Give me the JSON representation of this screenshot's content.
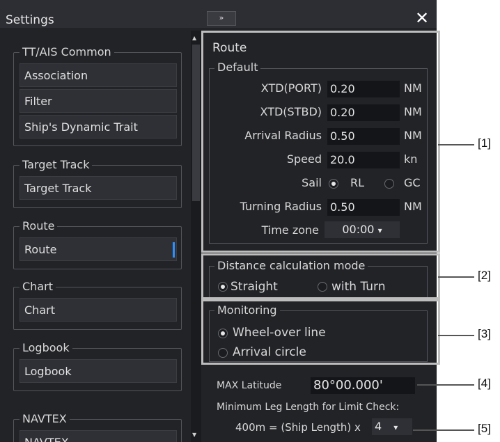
{
  "window": {
    "title": "Settings",
    "expand_icon": "double-chevron-right",
    "close_icon": "close-x"
  },
  "sidebar": {
    "groups": [
      {
        "title": "TT/AIS Common",
        "items": [
          "Association",
          "Filter",
          "Ship's Dynamic Trait"
        ]
      },
      {
        "title": "Target Track",
        "items": [
          "Target Track"
        ]
      },
      {
        "title": "Route",
        "items": [
          "Route"
        ],
        "selected": "Route"
      },
      {
        "title": "Chart",
        "items": [
          "Chart"
        ]
      },
      {
        "title": "Logbook",
        "items": [
          "Logbook"
        ]
      },
      {
        "title": "NAVTEX",
        "items": [
          "NAVTEX"
        ]
      }
    ]
  },
  "route": {
    "title": "Route",
    "default": {
      "title": "Default",
      "xtd_port": {
        "label": "XTD(PORT)",
        "value": "0.20",
        "unit": "NM"
      },
      "xtd_stbd": {
        "label": "XTD(STBD)",
        "value": "0.20",
        "unit": "NM"
      },
      "arrival_radius": {
        "label": "Arrival Radius",
        "value": "0.50",
        "unit": "NM"
      },
      "speed": {
        "label": "Speed",
        "value": "20.0",
        "unit": "kn"
      },
      "sail": {
        "label": "Sail",
        "options": [
          "RL",
          "GC"
        ],
        "selected": "RL"
      },
      "turning_radius": {
        "label": "Turning Radius",
        "value": "0.50",
        "unit": "NM"
      },
      "time_zone": {
        "label": "Time zone",
        "value": "00:00",
        "arrow": "▾"
      }
    },
    "distance_mode": {
      "title": "Distance calculation mode",
      "options": [
        "Straight",
        "with Turn"
      ],
      "selected": "Straight"
    },
    "monitoring": {
      "title": "Monitoring",
      "options": [
        "Wheel-over line",
        "Arrival circle"
      ],
      "selected": "Wheel-over line"
    },
    "max_latitude": {
      "label": "MAX Latitude",
      "value": "80°00.000'"
    },
    "min_leg": {
      "label": "Minimum Leg Length for Limit Check:",
      "formula": "400m = (Ship Length) x",
      "value": "4",
      "arrow": "▾"
    }
  },
  "callouts": [
    "[1]",
    "[2]",
    "[3]",
    "[4]",
    "[5]"
  ],
  "colors": {
    "accent": "#2e8fff",
    "window_bg": "#222327",
    "highlight_box": "#bdbdbd"
  }
}
